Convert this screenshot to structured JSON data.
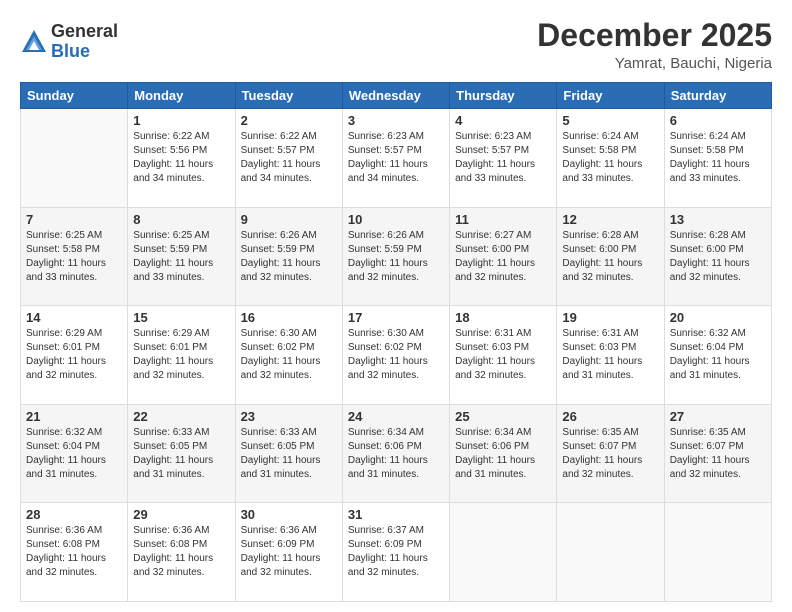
{
  "header": {
    "logo_general": "General",
    "logo_blue": "Blue",
    "month": "December 2025",
    "location": "Yamrat, Bauchi, Nigeria"
  },
  "days_of_week": [
    "Sunday",
    "Monday",
    "Tuesday",
    "Wednesday",
    "Thursday",
    "Friday",
    "Saturday"
  ],
  "weeks": [
    [
      {
        "day": "",
        "sunrise": "",
        "sunset": "",
        "daylight": ""
      },
      {
        "day": "1",
        "sunrise": "Sunrise: 6:22 AM",
        "sunset": "Sunset: 5:56 PM",
        "daylight": "Daylight: 11 hours and 34 minutes."
      },
      {
        "day": "2",
        "sunrise": "Sunrise: 6:22 AM",
        "sunset": "Sunset: 5:57 PM",
        "daylight": "Daylight: 11 hours and 34 minutes."
      },
      {
        "day": "3",
        "sunrise": "Sunrise: 6:23 AM",
        "sunset": "Sunset: 5:57 PM",
        "daylight": "Daylight: 11 hours and 34 minutes."
      },
      {
        "day": "4",
        "sunrise": "Sunrise: 6:23 AM",
        "sunset": "Sunset: 5:57 PM",
        "daylight": "Daylight: 11 hours and 33 minutes."
      },
      {
        "day": "5",
        "sunrise": "Sunrise: 6:24 AM",
        "sunset": "Sunset: 5:58 PM",
        "daylight": "Daylight: 11 hours and 33 minutes."
      },
      {
        "day": "6",
        "sunrise": "Sunrise: 6:24 AM",
        "sunset": "Sunset: 5:58 PM",
        "daylight": "Daylight: 11 hours and 33 minutes."
      }
    ],
    [
      {
        "day": "7",
        "sunrise": "Sunrise: 6:25 AM",
        "sunset": "Sunset: 5:58 PM",
        "daylight": "Daylight: 11 hours and 33 minutes."
      },
      {
        "day": "8",
        "sunrise": "Sunrise: 6:25 AM",
        "sunset": "Sunset: 5:59 PM",
        "daylight": "Daylight: 11 hours and 33 minutes."
      },
      {
        "day": "9",
        "sunrise": "Sunrise: 6:26 AM",
        "sunset": "Sunset: 5:59 PM",
        "daylight": "Daylight: 11 hours and 32 minutes."
      },
      {
        "day": "10",
        "sunrise": "Sunrise: 6:26 AM",
        "sunset": "Sunset: 5:59 PM",
        "daylight": "Daylight: 11 hours and 32 minutes."
      },
      {
        "day": "11",
        "sunrise": "Sunrise: 6:27 AM",
        "sunset": "Sunset: 6:00 PM",
        "daylight": "Daylight: 11 hours and 32 minutes."
      },
      {
        "day": "12",
        "sunrise": "Sunrise: 6:28 AM",
        "sunset": "Sunset: 6:00 PM",
        "daylight": "Daylight: 11 hours and 32 minutes."
      },
      {
        "day": "13",
        "sunrise": "Sunrise: 6:28 AM",
        "sunset": "Sunset: 6:00 PM",
        "daylight": "Daylight: 11 hours and 32 minutes."
      }
    ],
    [
      {
        "day": "14",
        "sunrise": "Sunrise: 6:29 AM",
        "sunset": "Sunset: 6:01 PM",
        "daylight": "Daylight: 11 hours and 32 minutes."
      },
      {
        "day": "15",
        "sunrise": "Sunrise: 6:29 AM",
        "sunset": "Sunset: 6:01 PM",
        "daylight": "Daylight: 11 hours and 32 minutes."
      },
      {
        "day": "16",
        "sunrise": "Sunrise: 6:30 AM",
        "sunset": "Sunset: 6:02 PM",
        "daylight": "Daylight: 11 hours and 32 minutes."
      },
      {
        "day": "17",
        "sunrise": "Sunrise: 6:30 AM",
        "sunset": "Sunset: 6:02 PM",
        "daylight": "Daylight: 11 hours and 32 minutes."
      },
      {
        "day": "18",
        "sunrise": "Sunrise: 6:31 AM",
        "sunset": "Sunset: 6:03 PM",
        "daylight": "Daylight: 11 hours and 32 minutes."
      },
      {
        "day": "19",
        "sunrise": "Sunrise: 6:31 AM",
        "sunset": "Sunset: 6:03 PM",
        "daylight": "Daylight: 11 hours and 31 minutes."
      },
      {
        "day": "20",
        "sunrise": "Sunrise: 6:32 AM",
        "sunset": "Sunset: 6:04 PM",
        "daylight": "Daylight: 11 hours and 31 minutes."
      }
    ],
    [
      {
        "day": "21",
        "sunrise": "Sunrise: 6:32 AM",
        "sunset": "Sunset: 6:04 PM",
        "daylight": "Daylight: 11 hours and 31 minutes."
      },
      {
        "day": "22",
        "sunrise": "Sunrise: 6:33 AM",
        "sunset": "Sunset: 6:05 PM",
        "daylight": "Daylight: 11 hours and 31 minutes."
      },
      {
        "day": "23",
        "sunrise": "Sunrise: 6:33 AM",
        "sunset": "Sunset: 6:05 PM",
        "daylight": "Daylight: 11 hours and 31 minutes."
      },
      {
        "day": "24",
        "sunrise": "Sunrise: 6:34 AM",
        "sunset": "Sunset: 6:06 PM",
        "daylight": "Daylight: 11 hours and 31 minutes."
      },
      {
        "day": "25",
        "sunrise": "Sunrise: 6:34 AM",
        "sunset": "Sunset: 6:06 PM",
        "daylight": "Daylight: 11 hours and 31 minutes."
      },
      {
        "day": "26",
        "sunrise": "Sunrise: 6:35 AM",
        "sunset": "Sunset: 6:07 PM",
        "daylight": "Daylight: 11 hours and 32 minutes."
      },
      {
        "day": "27",
        "sunrise": "Sunrise: 6:35 AM",
        "sunset": "Sunset: 6:07 PM",
        "daylight": "Daylight: 11 hours and 32 minutes."
      }
    ],
    [
      {
        "day": "28",
        "sunrise": "Sunrise: 6:36 AM",
        "sunset": "Sunset: 6:08 PM",
        "daylight": "Daylight: 11 hours and 32 minutes."
      },
      {
        "day": "29",
        "sunrise": "Sunrise: 6:36 AM",
        "sunset": "Sunset: 6:08 PM",
        "daylight": "Daylight: 11 hours and 32 minutes."
      },
      {
        "day": "30",
        "sunrise": "Sunrise: 6:36 AM",
        "sunset": "Sunset: 6:09 PM",
        "daylight": "Daylight: 11 hours and 32 minutes."
      },
      {
        "day": "31",
        "sunrise": "Sunrise: 6:37 AM",
        "sunset": "Sunset: 6:09 PM",
        "daylight": "Daylight: 11 hours and 32 minutes."
      },
      {
        "day": "",
        "sunrise": "",
        "sunset": "",
        "daylight": ""
      },
      {
        "day": "",
        "sunrise": "",
        "sunset": "",
        "daylight": ""
      },
      {
        "day": "",
        "sunrise": "",
        "sunset": "",
        "daylight": ""
      }
    ]
  ]
}
